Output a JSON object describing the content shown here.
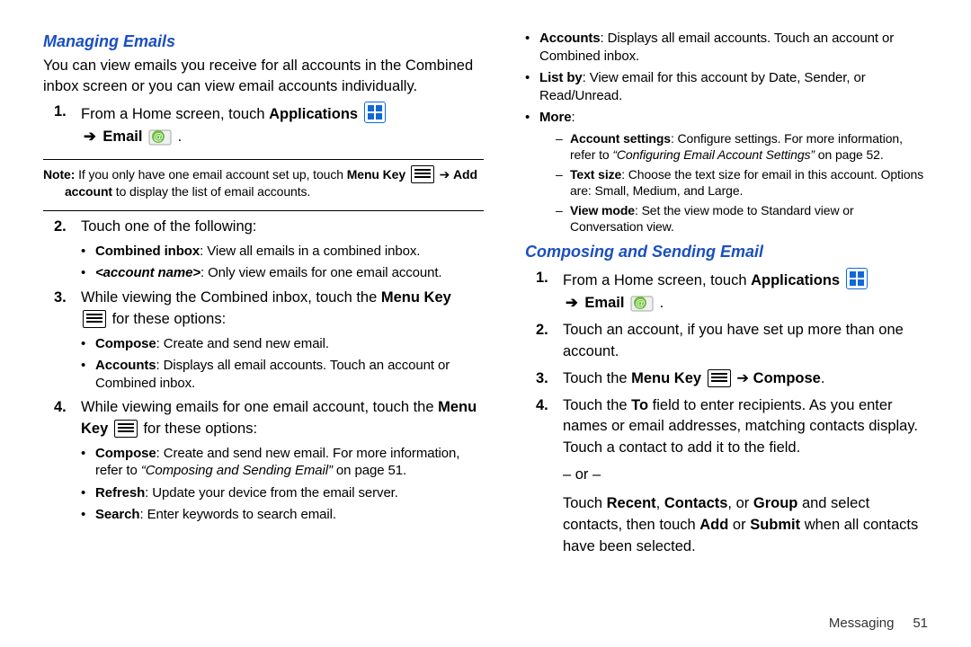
{
  "left": {
    "heading1": "Managing Emails",
    "intro": "You can view emails you receive for all accounts in the Combined inbox screen or you can view email accounts individually.",
    "step1_pre": "From a Home screen, touch ",
    "step1_apps": "Applications",
    "step1_arrow": "➔",
    "step1_email": "Email",
    "step1_tail": " .",
    "note_pre": "Note:",
    "note_body1": " If you only have one email account set up, touch ",
    "note_menukey": "Menu Key",
    "note_arrow": " ➔ ",
    "note_add": "Add account",
    "note_body2": " to display the list of email accounts.",
    "step2": "Touch one of the following:",
    "s2_a_b": "Combined inbox",
    "s2_a_t": ": View all emails in a combined inbox.",
    "s2_b_i": "<account name>",
    "s2_b_t": ": Only view emails for one email account.",
    "step3_pre": "While viewing the Combined inbox, touch the ",
    "step3_mk": "Menu Key",
    "step3_post": " for these options:",
    "s3_a_b": "Compose",
    "s3_a_t": ": Create and send new email.",
    "s3_b_b": "Accounts",
    "s3_b_t": ": Displays all email accounts. Touch an account or Combined inbox.",
    "step4_pre": "While viewing emails for one email account, touch the ",
    "step4_mk": "Menu Key",
    "step4_post": " for these options:",
    "s4_a_b": "Compose",
    "s4_a_t": ": Create and send new email. For more information, refer to ",
    "s4_a_x": "“Composing and Sending Email”",
    "s4_a_pg": " on page 51.",
    "s4_b_b": "Refresh",
    "s4_b_t": ": Update your device from the email server.",
    "s4_c_b": "Search",
    "s4_c_t": ": Enter keywords to search email."
  },
  "right": {
    "cont_a_b": "Accounts",
    "cont_a_t": ": Displays all email accounts. Touch an account or Combined inbox.",
    "cont_b_b": "List by",
    "cont_b_t": ": View email for this account by Date, Sender, or Read/Unread.",
    "cont_c_b": "More",
    "cont_c_t": ":",
    "more_1_b": "Account settings",
    "more_1_t": ": Configure settings. For more information, refer to ",
    "more_1_x": "“Configuring Email Account Settings”",
    "more_1_pg": " on page 52.",
    "more_2_b": "Text size",
    "more_2_t": ": Choose the text size for email in this account. Options are: Small, Medium, and Large.",
    "more_3_b": "View mode",
    "more_3_t": ": Set the view mode to Standard view or Conversation view.",
    "heading2": "Composing and Sending Email",
    "c_step1_pre": "From a Home screen, touch ",
    "c_step1_apps": "Applications",
    "c_step1_arrow": "➔",
    "c_step1_email": "Email",
    "c_step1_tail": " .",
    "c_step2": "Touch an account, if you have set up more than one account.",
    "c_step3_pre": "Touch the ",
    "c_step3_mk": "Menu Key",
    "c_step3_arrow": " ➔ ",
    "c_step3_comp": "Compose",
    "c_step3_tail": ".",
    "c_step4_a_pre": "Touch the ",
    "c_step4_a_to": "To",
    "c_step4_a_post": " field to enter recipients. As you enter names or email addresses, matching contacts display. Touch a contact to add it to the field.",
    "or": "– or –",
    "c_step4_b_pre": "Touch ",
    "c_step4_b_r": "Recent",
    "c_step4_b_c1": ", ",
    "c_step4_b_co": "Contacts",
    "c_step4_b_c2": ", or ",
    "c_step4_b_g": "Group",
    "c_step4_b_mid": " and select contacts, then touch ",
    "c_step4_b_add": "Add",
    "c_step4_b_c3": " or ",
    "c_step4_b_sub": "Submit",
    "c_step4_b_end": " when all contacts have been selected."
  },
  "footer": {
    "section": "Messaging",
    "page": "51"
  }
}
